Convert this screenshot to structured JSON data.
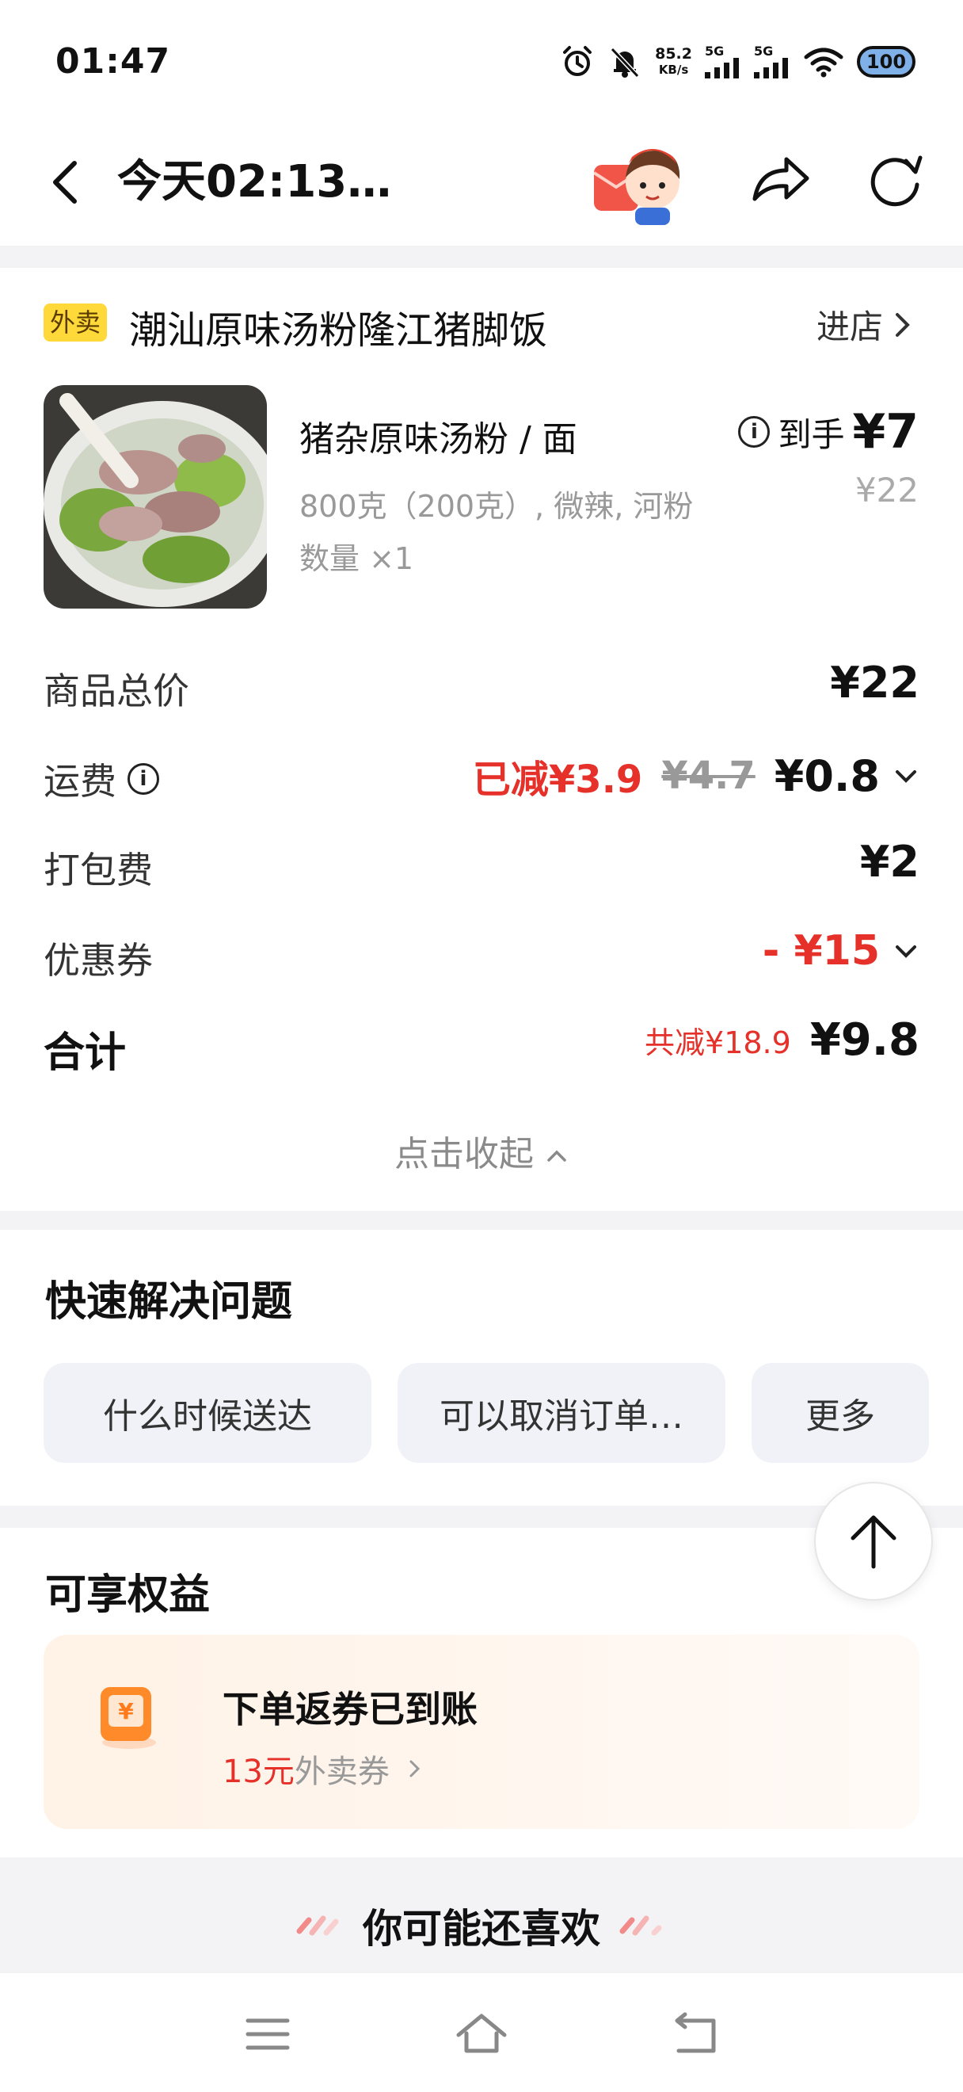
{
  "status_bar": {
    "time": "01:47",
    "net_speed_value": "85.2",
    "net_speed_unit": "KB/s",
    "signal1_label": "5G",
    "signal2_label": "5G",
    "battery": "100",
    "icons": [
      "alarm-icon",
      "bell-muted-icon",
      "signal-icon",
      "wifi-icon",
      "battery-icon"
    ]
  },
  "nav": {
    "title": "今天02:13…",
    "icons": [
      "back-icon",
      "mascot-icon",
      "share-icon",
      "refresh-icon"
    ]
  },
  "order": {
    "tag": "外卖",
    "store_name": "潮汕原味汤粉隆江猪脚饭",
    "enter_store": "进店",
    "item": {
      "name": "猪杂原味汤粉 / 面",
      "spec": "800克（200克）, 微辣, 河粉",
      "qty": "数量 ×1",
      "final_label": "到手",
      "final_price": "¥7",
      "orig_price": "¥22"
    },
    "rows": {
      "goods_total_label": "商品总价",
      "goods_total": "¥22",
      "delivery_label": "运费",
      "delivery_saved": "已减¥3.9",
      "delivery_orig": "¥4.7",
      "delivery_fee": "¥0.8",
      "packing_label": "打包费",
      "packing_fee": "¥2",
      "coupon_label": "优惠券",
      "coupon_value": "- ¥15",
      "total_label": "合计",
      "total_saved": "共减¥18.9",
      "total_value": "¥9.8"
    },
    "collapse": "点击收起"
  },
  "quick": {
    "title": "快速解决问题",
    "chips": [
      "什么时候送达",
      "可以取消订单…",
      "更多"
    ]
  },
  "benefits": {
    "title": "可享权益",
    "card_title": "下单返券已到账",
    "amount": "13元",
    "coupon_type": "外卖券"
  },
  "recommend": "你可能还喜欢",
  "colors": {
    "accent_red": "#e5312a",
    "tag_yellow": "#ffd83a",
    "coupon_orange": "#ff8a2a"
  }
}
